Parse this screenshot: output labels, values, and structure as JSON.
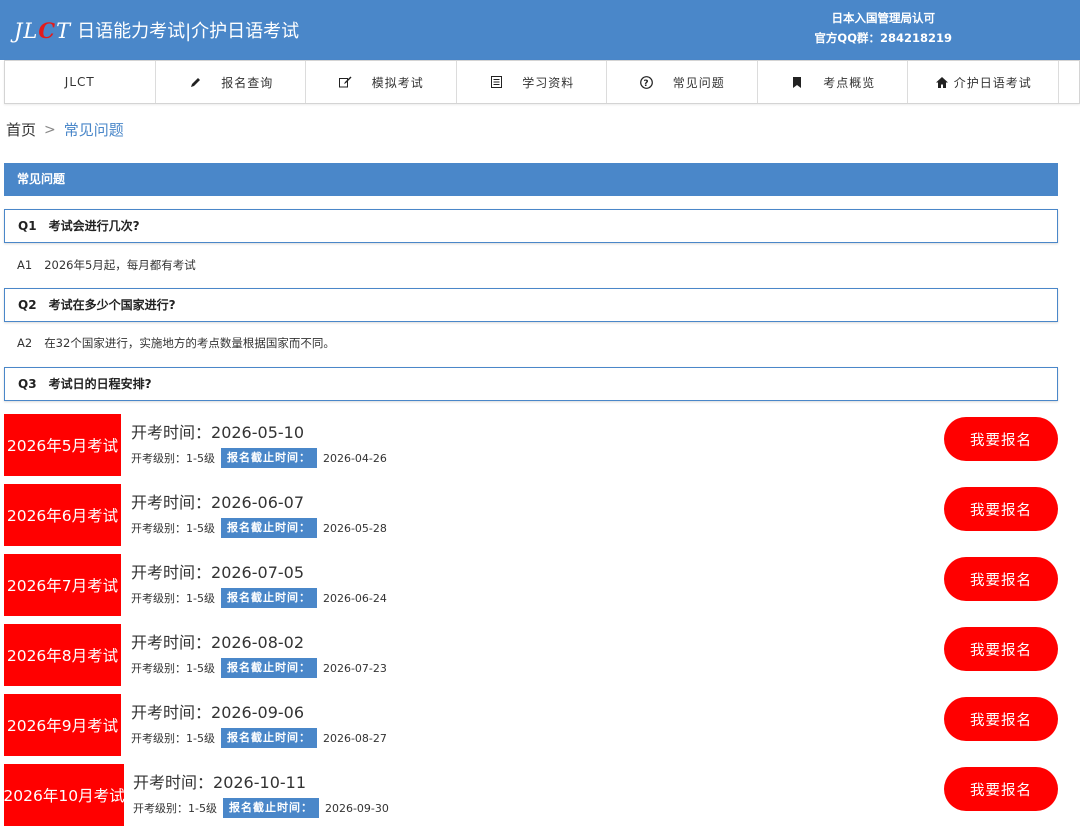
{
  "header": {
    "logo_text": [
      "JL",
      "C",
      "T"
    ],
    "title": "日语能力考试|介护日语考试",
    "approval": "日本入国管理局认可",
    "qq_group": "官方QQ群：284218219"
  },
  "nav": {
    "items": [
      {
        "label": "JLCT",
        "icon": ""
      },
      {
        "label": "报名查询",
        "icon": "✎"
      },
      {
        "label": "模拟考试",
        "icon": "✍"
      },
      {
        "label": "学习资料",
        "icon": "▤"
      },
      {
        "label": "常见问题",
        "icon": "?"
      },
      {
        "label": "考点概览",
        "icon": "▮"
      },
      {
        "label": "介护日语考试",
        "icon": "⌂"
      }
    ]
  },
  "breadcrumb": {
    "home": "首页",
    "separator": ">",
    "current": "常见问题"
  },
  "section_title": "常见问题",
  "faq": [
    {
      "q_num": "Q1",
      "question": "考试会进行几次?",
      "a_num": "A1",
      "answer": "2026年5月起，每月都有考试"
    },
    {
      "q_num": "Q2",
      "question": "考试在多少个国家进行?",
      "a_num": "A2",
      "answer": "在32个国家进行，实施地方的考点数量根据国家而不同。"
    },
    {
      "q_num": "Q3",
      "question": "考试日的日程安排?",
      "a_num": "",
      "answer": ""
    }
  ],
  "exams": [
    {
      "tag": "2026年5月考试",
      "time_label": "开考时间：",
      "date": "2026-05-10",
      "level": "开考级别：1-5级",
      "deadline_label": "报名截止时间：",
      "deadline": "2026-04-26",
      "button": "我要报名"
    },
    {
      "tag": "2026年6月考试",
      "time_label": "开考时间：",
      "date": "2026-06-07",
      "level": "开考级别：1-5级",
      "deadline_label": "报名截止时间：",
      "deadline": "2026-05-28",
      "button": "我要报名"
    },
    {
      "tag": "2026年7月考试",
      "time_label": "开考时间：",
      "date": "2026-07-05",
      "level": "开考级别：1-5级",
      "deadline_label": "报名截止时间：",
      "deadline": "2026-06-24",
      "button": "我要报名"
    },
    {
      "tag": "2026年8月考试",
      "time_label": "开考时间：",
      "date": "2026-08-02",
      "level": "开考级别：1-5级",
      "deadline_label": "报名截止时间：",
      "deadline": "2026-07-23",
      "button": "我要报名"
    },
    {
      "tag": "2026年9月考试",
      "time_label": "开考时间：",
      "date": "2026-09-06",
      "level": "开考级别：1-5级",
      "deadline_label": "报名截止时间：",
      "deadline": "2026-08-27",
      "button": "我要报名"
    },
    {
      "tag": "2026年10月考试",
      "time_label": "开考时间：",
      "date": "2026-10-11",
      "level": "开考级别：1-5级",
      "deadline_label": "报名截止时间：",
      "deadline": "2026-09-30",
      "button": "我要报名"
    }
  ],
  "icons": {
    "pencil": "pencil-icon",
    "edit": "edit-icon",
    "document": "document-icon",
    "question": "question-circle-icon",
    "bookmark": "bookmark-icon",
    "home": "home-icon"
  },
  "colors": {
    "brand_blue": "#4a87c9",
    "accent_red": "#ff0000",
    "logo_red": "#e31b1b"
  }
}
